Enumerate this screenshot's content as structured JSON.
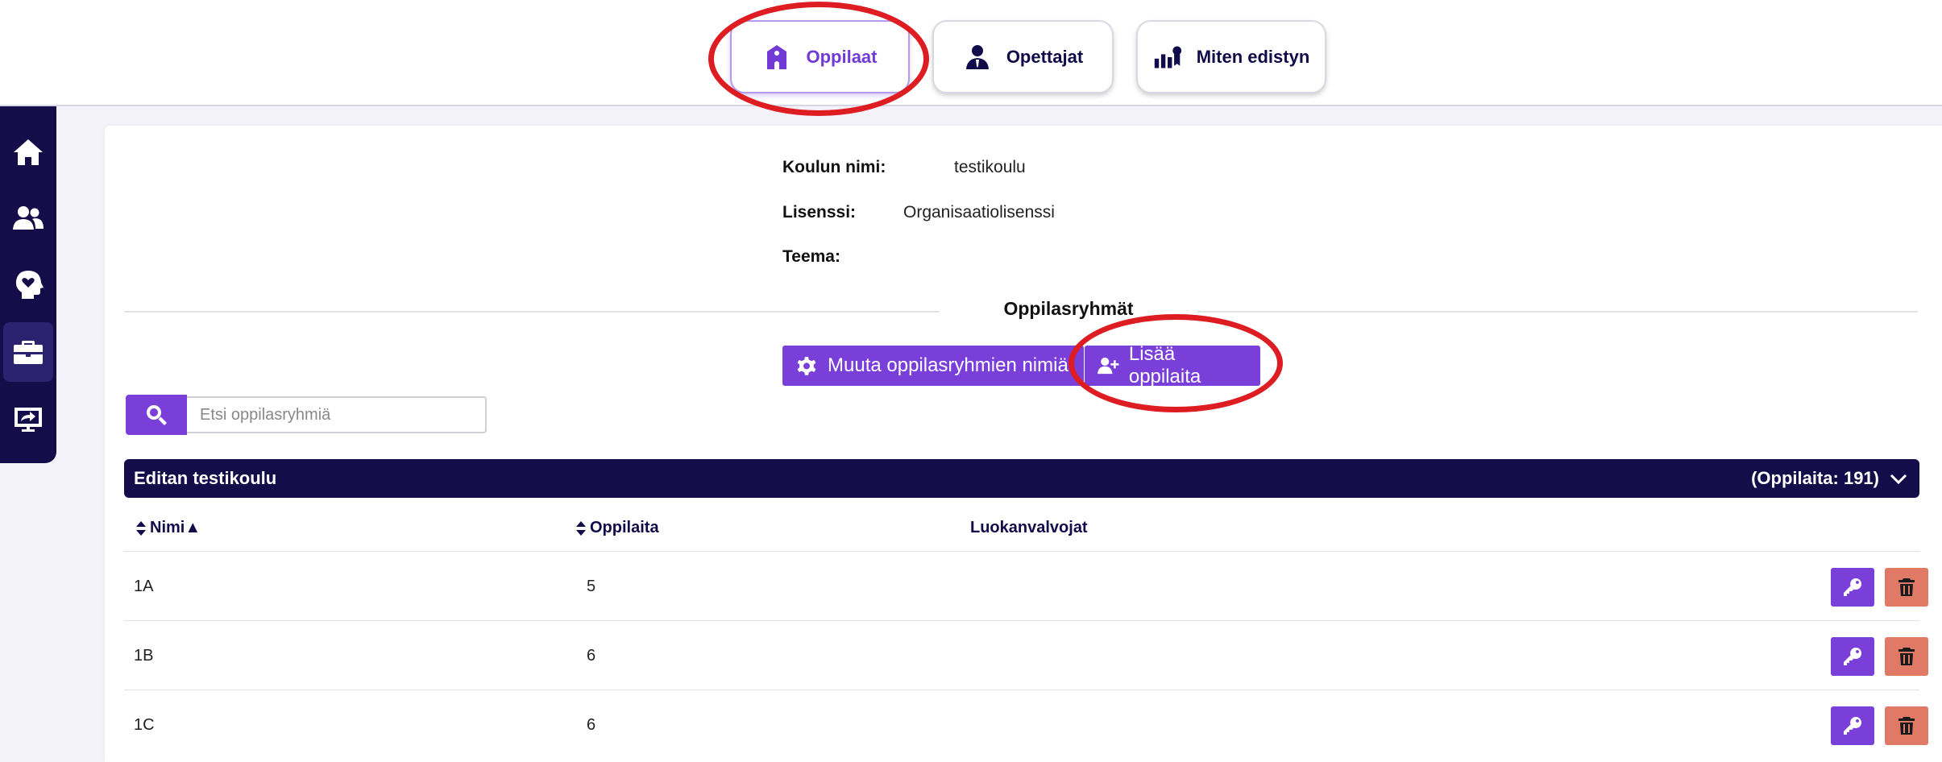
{
  "nav": {
    "tabs": [
      {
        "label": "Oppilaat",
        "icon": "school-icon",
        "active": true
      },
      {
        "label": "Opettajat",
        "icon": "teacher-icon",
        "active": false
      },
      {
        "label": "Miten edistyn",
        "icon": "progress-award-icon",
        "active": false
      }
    ]
  },
  "sidebar": {
    "items": [
      {
        "name": "home",
        "icon": "home-icon"
      },
      {
        "name": "users",
        "icon": "users-icon"
      },
      {
        "name": "wellbeing",
        "icon": "heart-head-icon"
      },
      {
        "name": "admin",
        "icon": "briefcase-icon",
        "active": true
      },
      {
        "name": "presentation",
        "icon": "screen-share-icon"
      }
    ]
  },
  "school": {
    "name_label": "Koulun nimi:",
    "name_value": "testikoulu",
    "license_label": "Lisenssi:",
    "license_value": "Organisaatiolisenssi",
    "theme_label": "Teema:",
    "theme_value": ""
  },
  "groups_section": {
    "title": "Oppilasryhmät",
    "rename_button": "Muuta oppilasryhmien nimiä",
    "add_students_button": "Lisää oppilaita",
    "search_placeholder": "Etsi oppilasryhmiä"
  },
  "group": {
    "name": "Editan testikoulu",
    "count_text": "(Oppilaita: 191)"
  },
  "table": {
    "columns": [
      "Nimi▲",
      "Oppilaita",
      "Luokanvalvojat"
    ],
    "rows": [
      {
        "name": "1A",
        "students": "5",
        "supervisors": ""
      },
      {
        "name": "1B",
        "students": "6",
        "supervisors": ""
      },
      {
        "name": "1C",
        "students": "6",
        "supervisors": ""
      }
    ]
  },
  "colors": {
    "accent": "#7a3fd8",
    "navy": "#150c4a",
    "delete": "#e07a66",
    "highlight_ring": "#dd1d22"
  }
}
